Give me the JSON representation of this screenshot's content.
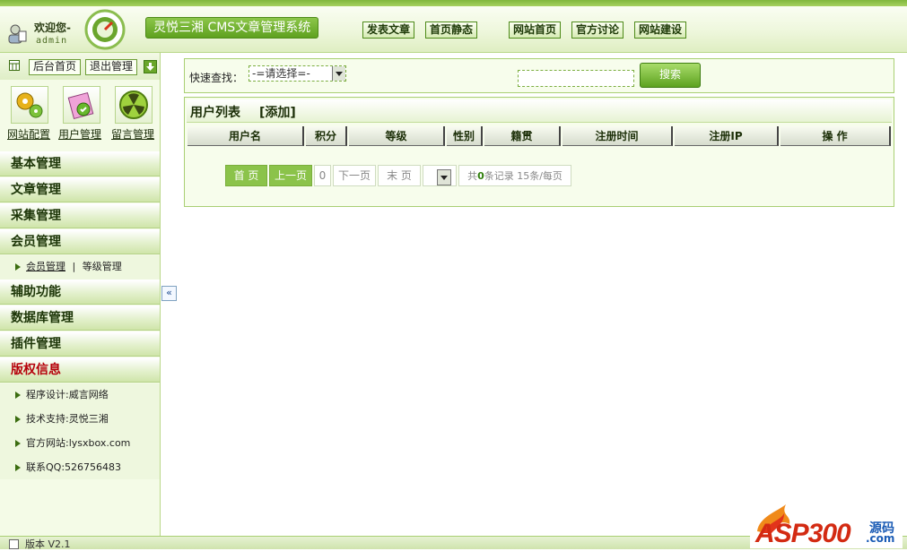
{
  "header": {
    "welcome": "欢迎您-",
    "username": "admin",
    "system_title": "灵悦三湘 CMS文章管理系统",
    "nav": [
      "发表文章",
      "首页静态",
      "网站首页",
      "官方讨论",
      "网站建设"
    ]
  },
  "sidebar": {
    "top_buttons": [
      "后台首页",
      "退出管理"
    ],
    "quick_links": [
      "网站配置",
      "用户管理",
      "留言管理"
    ],
    "menus": [
      "基本管理",
      "文章管理",
      "采集管理",
      "会员管理",
      "辅助功能",
      "数据库管理",
      "插件管理",
      "版权信息"
    ],
    "member_sub": {
      "active": "会员管理",
      "separator": "|",
      "other": "等级管理"
    },
    "copyright_items": [
      "程序设计:威言网络",
      "技术支持:灵悦三湘",
      "官方网站:lysxbox.com",
      "联系QQ:526756483"
    ],
    "collapse": "«"
  },
  "search": {
    "label": "快速查找：",
    "select_value": "-=请选择=-",
    "button": "搜索"
  },
  "list": {
    "title": "用户列表",
    "add": "[添加]",
    "columns": [
      "用户名",
      "积分",
      "等级",
      "性别",
      "籍贯",
      "注册时间",
      "注册IP",
      "操 作"
    ]
  },
  "pagination": {
    "first": "首  页",
    "prev": "上一页",
    "current": "0",
    "next": "下一页",
    "last": "末  页",
    "info_prefix": "共",
    "total": "0",
    "info_suffix": "条记录 15条/每页"
  },
  "footer": {
    "version": "版本 V2.1"
  },
  "watermark": {
    "brand": "ASP300",
    "suffix": "源码",
    "domain": ".com"
  },
  "colors": {
    "accent": "#5fa11f",
    "menu_red": "#b5000a",
    "panel_bg": "#f7fdec"
  }
}
